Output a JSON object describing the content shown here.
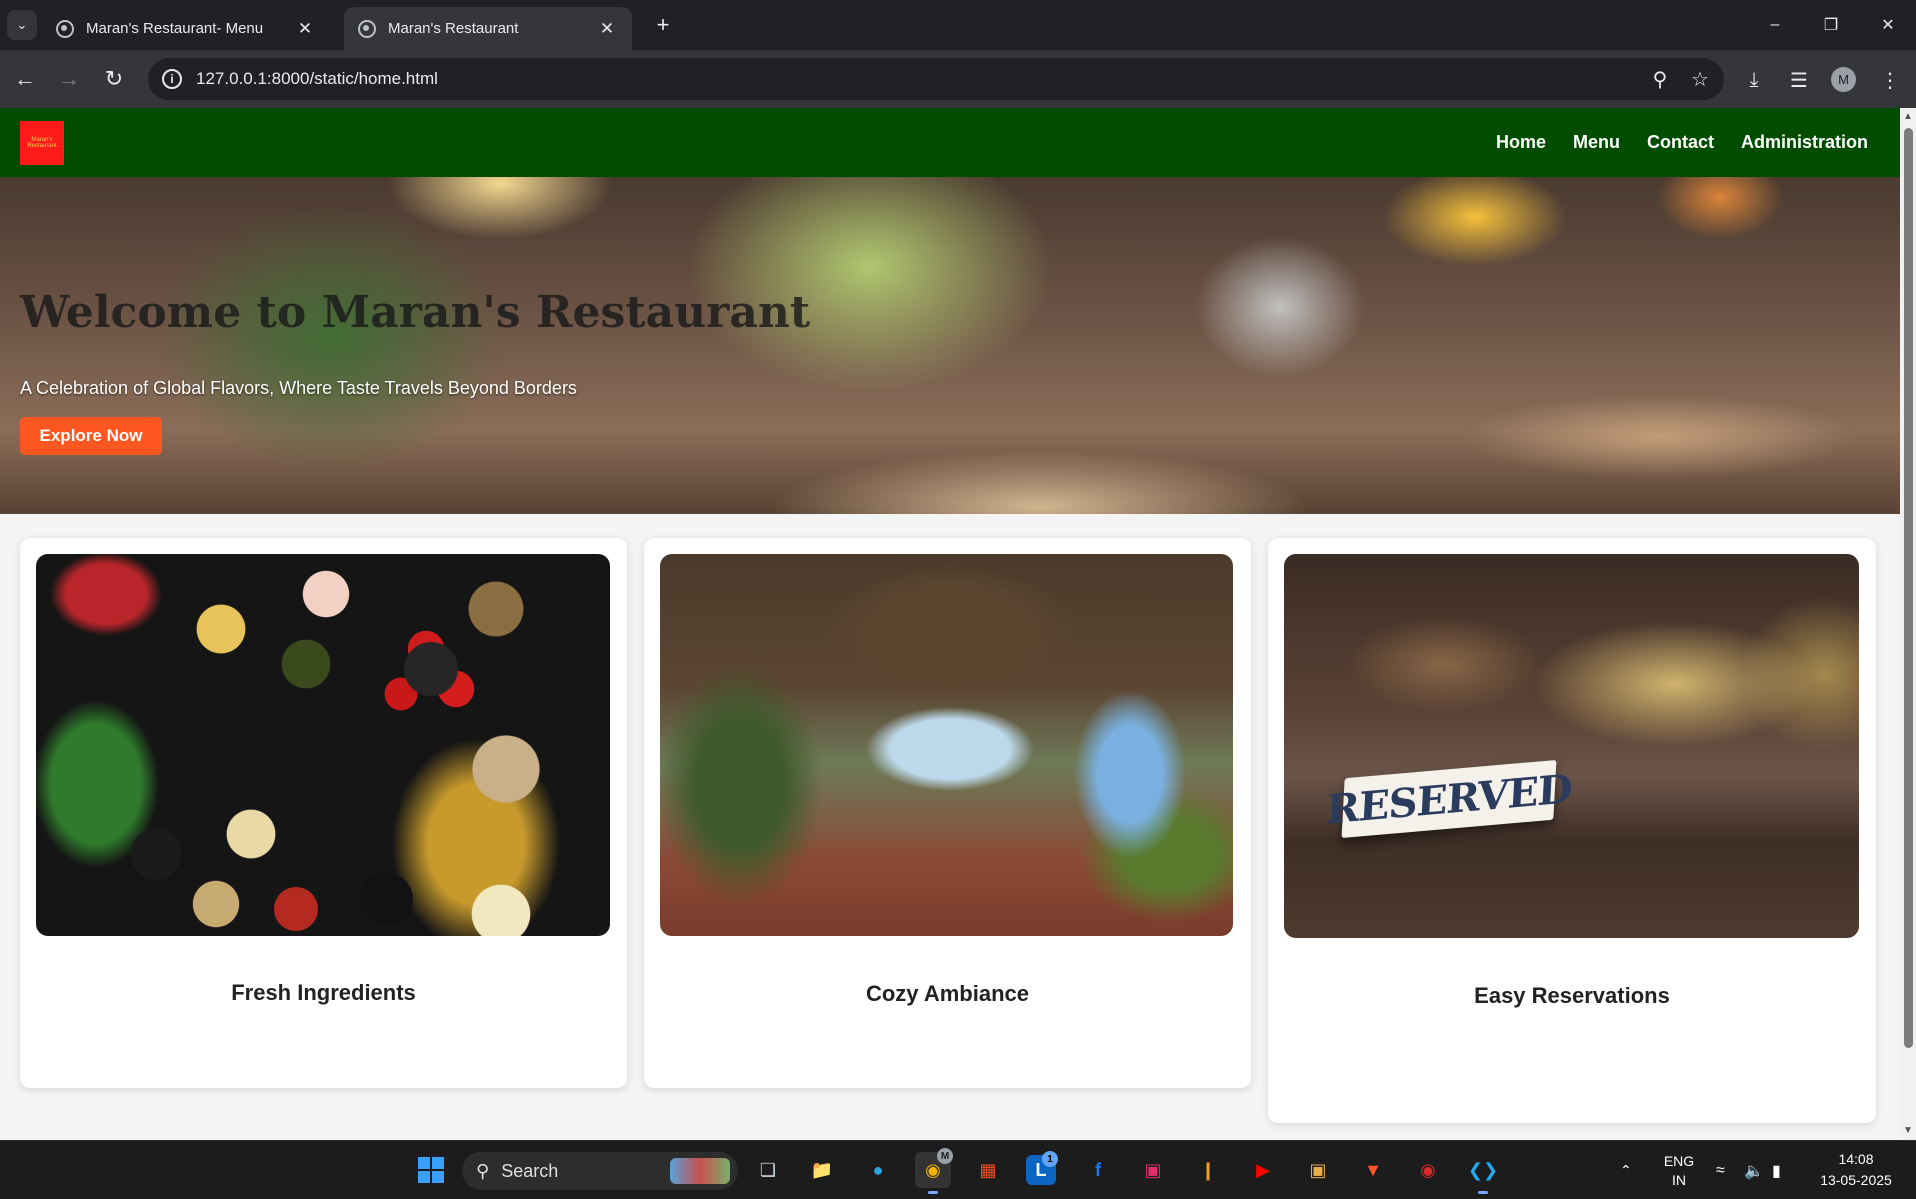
{
  "browser": {
    "tabs": [
      {
        "title": "Maran's Restaurant- Menu",
        "active": false
      },
      {
        "title": "Maran's Restaurant",
        "active": true
      }
    ],
    "url": "127.0.0.1:8000/static/home.html",
    "profile_initial": "M"
  },
  "site": {
    "logo_text": "Maran's Restaurant",
    "nav": [
      "Home",
      "Menu",
      "Contact",
      "Administration"
    ],
    "hero": {
      "title": "Welcome to Maran's Restaurant",
      "subtitle": "A Celebration of Global Flavors, Where Taste Travels Beyond Borders",
      "cta": "Explore Now"
    },
    "features": [
      {
        "caption": "Fresh Ingredients",
        "image": "fresh-ingredients-photo"
      },
      {
        "caption": "Cozy Ambiance",
        "image": "outdoor-dining-terrace-photo"
      },
      {
        "caption": "Easy Reservations",
        "image": "reserved-table-sign-photo",
        "sign_text": "RESERVED"
      }
    ]
  },
  "taskbar": {
    "search_label": "Search",
    "apps": [
      "start",
      "search",
      "task-view",
      "file-explorer",
      "edge",
      "chrome",
      "microsoft-store",
      "linkedin",
      "facebook",
      "instagram",
      "app-pin",
      "youtube",
      "game",
      "brave",
      "app-red",
      "vscode"
    ],
    "linkedin_badge": "1",
    "chrome_badge": "M",
    "language": "ENG",
    "region": "IN",
    "time": "14:08",
    "date": "13-05-2025"
  },
  "colors": {
    "nav_bg": "#004d00",
    "cta_bg": "#ff5722",
    "logo_bg": "#ff1a1a"
  }
}
